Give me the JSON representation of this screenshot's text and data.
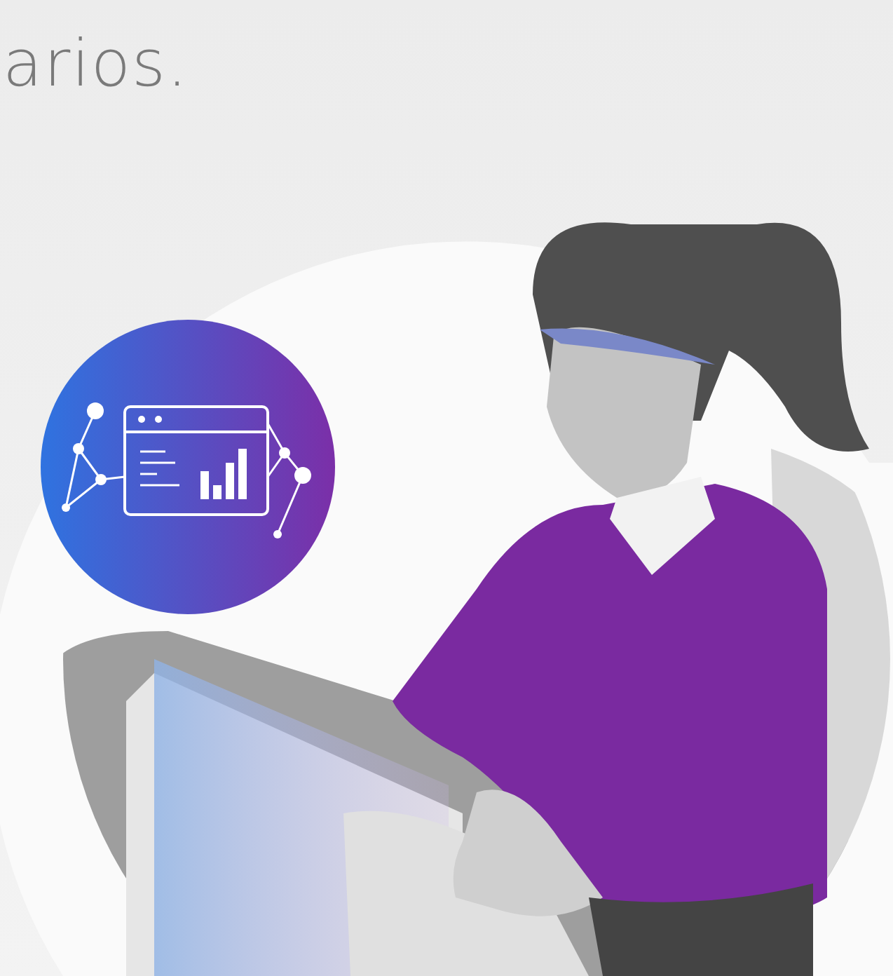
{
  "heading_fragment": "arios."
}
